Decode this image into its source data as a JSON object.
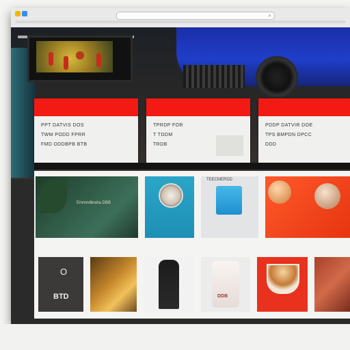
{
  "browser": {
    "address": "",
    "address_icon": "⌕"
  },
  "hero": {
    "cards": [
      {
        "title": "",
        "lines": [
          "PPT DATVIS DOS",
          "TWM PODD FPRR",
          "FMD DDDBPB BTB"
        ]
      },
      {
        "title": "",
        "lines": [
          "TPRDP FOR",
          "T TDDM",
          "TRDB"
        ]
      },
      {
        "title": "",
        "lines": [
          "PDDP DATVIR DOE",
          "TPS BMPDN DPCC",
          "DDD"
        ]
      }
    ]
  },
  "gallery": {
    "row1": [
      {
        "label": "Emmndbraha DBB"
      },
      {
        "label": ""
      },
      {
        "label": "TEECMERDD"
      },
      {
        "label": ""
      }
    ],
    "row2": [
      {
        "label": "BTD",
        "badge": "O"
      },
      {
        "label": ""
      },
      {
        "label": ""
      },
      {
        "label": "DDB"
      },
      {
        "label": ""
      },
      {
        "label": ""
      }
    ]
  },
  "colors": {
    "accent": "#f21a12",
    "hero_blue": "#1f3ec9",
    "panel": "#f0f0ee"
  }
}
